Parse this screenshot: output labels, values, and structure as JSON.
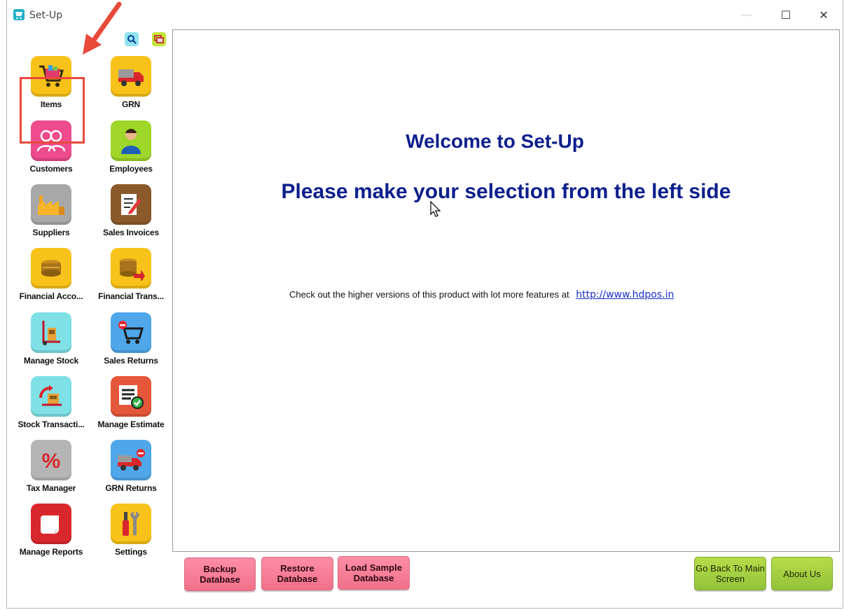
{
  "window": {
    "title": "Set-Up",
    "controls": {
      "minimize": "—",
      "maximize": "☐",
      "close": "✕"
    }
  },
  "toolbar": {
    "icons": [
      "search-icon",
      "window-icon"
    ]
  },
  "tiles": [
    {
      "label": "Items",
      "icon": "shopping-cart-icon",
      "color": "#f7c21a"
    },
    {
      "label": "GRN",
      "icon": "delivery-truck-icon",
      "color": "#f7c21a"
    },
    {
      "label": "Customers",
      "icon": "people-icon",
      "color": "#ee4c8d"
    },
    {
      "label": "Employees",
      "icon": "person-icon",
      "color": "#9ed62a"
    },
    {
      "label": "Suppliers",
      "icon": "factory-icon",
      "color": "#a8a8a8"
    },
    {
      "label": "Sales Invoices",
      "icon": "invoice-edit-icon",
      "color": "#8b5a2b"
    },
    {
      "label": "Financial Acco...",
      "icon": "coins-icon",
      "color": "#f7c21a"
    },
    {
      "label": "Financial Trans...",
      "icon": "coins-transfer-icon",
      "color": "#f7c21a"
    },
    {
      "label": "Manage Stock",
      "icon": "hand-truck-icon",
      "color": "#7fe0e6"
    },
    {
      "label": "Sales Returns",
      "icon": "cart-return-icon",
      "color": "#4fa7ea"
    },
    {
      "label": "Stock Transacti...",
      "icon": "stock-transfer-icon",
      "color": "#7fe0e6"
    },
    {
      "label": "Manage Estimate",
      "icon": "estimate-check-icon",
      "color": "#e5573a"
    },
    {
      "label": "Tax Manager",
      "icon": "percent-icon",
      "color": "#b5b5b5"
    },
    {
      "label": "GRN Returns",
      "icon": "truck-return-icon",
      "color": "#4fa7ea"
    },
    {
      "label": "Manage Reports",
      "icon": "report-scroll-icon",
      "color": "#d9282c"
    },
    {
      "label": "Settings",
      "icon": "tools-icon",
      "color": "#f7c21a"
    }
  ],
  "main": {
    "welcome": "Welcome to Set-Up",
    "instruction": "Please make your selection from the left side",
    "promo_text": "Check out the higher versions of this product with lot more features at",
    "promo_link": "http://www.hdpos.in"
  },
  "buttons": {
    "backup": "Backup Database",
    "restore": "Restore Database",
    "load_sample": "Load Sample Database",
    "go_back": "Go Back To Main Screen",
    "about": "About Us"
  },
  "colors": {
    "heading": "#0c1f8c",
    "highlight": "#e84a3a",
    "pink_button": "#f37f97",
    "green_button": "#a3cc3f"
  }
}
